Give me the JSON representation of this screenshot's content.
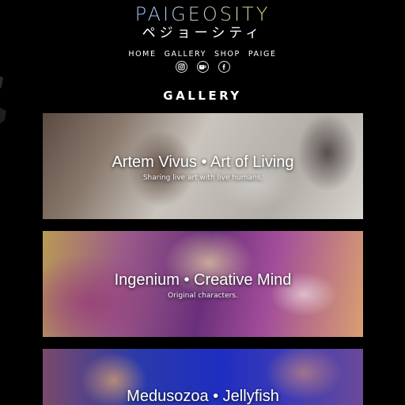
{
  "header": {
    "logo_text": "PAIGEOSITY",
    "logo_subtext": "ペジョーシティ"
  },
  "nav": {
    "items": [
      "HOME",
      "GALLERY",
      "SHOP",
      "PAIGE"
    ]
  },
  "social": {
    "icons": [
      "instagram-icon",
      "ko-fi-icon",
      "facebook-icon"
    ]
  },
  "page_title": "GALLERY",
  "gallery": {
    "items": [
      {
        "title": "Artem Vivus • Art of  Living",
        "subtitle": "Sharing live art with live humans."
      },
      {
        "title": "Ingenium • Creative Mind",
        "subtitle": "Original characters."
      },
      {
        "title": "Medusozoa • Jellyfish",
        "subtitle": ""
      }
    ]
  },
  "colors": {
    "background": "#000000",
    "text": "#ffffff"
  }
}
